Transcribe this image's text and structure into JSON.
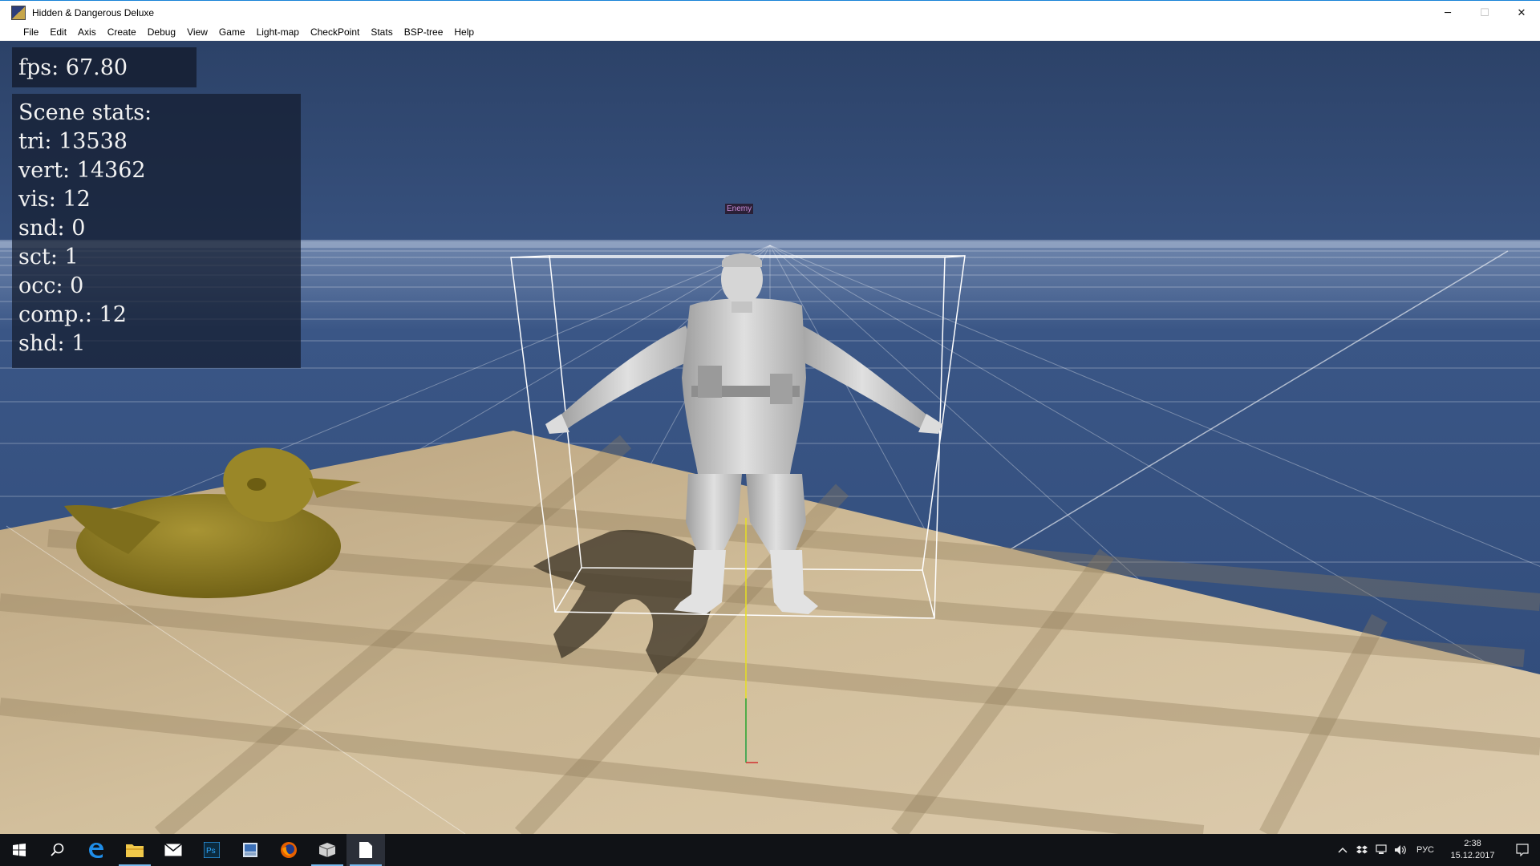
{
  "window": {
    "title": "Hidden & Dangerous Deluxe",
    "app_icon": "hd-app-icon",
    "controls": {
      "minimize": "─",
      "maximize": "☐",
      "close": "✕"
    }
  },
  "menu": [
    "File",
    "Edit",
    "Axis",
    "Create",
    "Debug",
    "View",
    "Game",
    "Light-map",
    "CheckPoint",
    "Stats",
    "BSP-tree",
    "Help"
  ],
  "viewport": {
    "fps": "fps:  67.80",
    "stats": [
      "Scene  stats:",
      "tri:  13538",
      "vert:  14362",
      "vis:  12",
      "snd:  0",
      "sct:  1",
      "occ:  0",
      "comp.:  12",
      "shd:  1"
    ],
    "object_label": "Enemy",
    "colors": {
      "sky": "#2e4670",
      "grid": "#ffffff",
      "floor": "#cdb895",
      "duck": "#8f7f22",
      "soldier": "#c9c9c9",
      "bbox": "#ffffff",
      "axis_y": "#e8e020",
      "axis_z": "#20a040",
      "axis_x": "#d03030"
    }
  },
  "taskbar": {
    "apps": [
      {
        "icon": "windows-start-icon"
      },
      {
        "icon": "search-icon"
      },
      {
        "icon": "edge-browser-icon"
      },
      {
        "icon": "file-explorer-icon"
      },
      {
        "icon": "mail-icon"
      },
      {
        "icon": "photoshop-icon",
        "label": "Ps"
      },
      {
        "icon": "image-viewer-icon"
      },
      {
        "icon": "firefox-icon"
      },
      {
        "icon": "3d-editor-icon"
      },
      {
        "icon": "notepad-icon"
      }
    ],
    "language": "РУС",
    "time": "2:38",
    "date": "15.12.2017"
  }
}
